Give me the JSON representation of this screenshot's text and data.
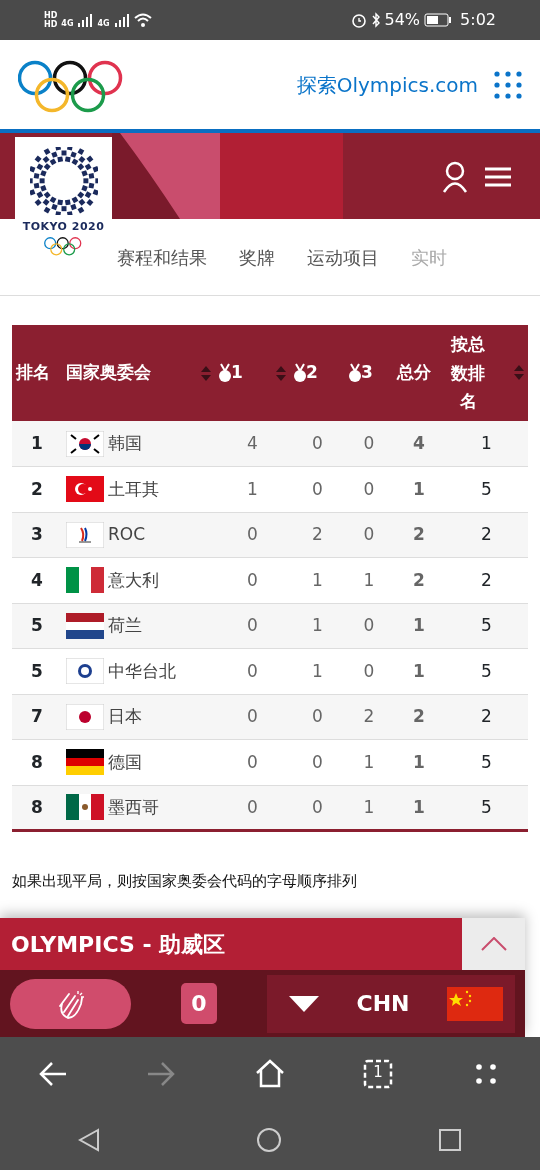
{
  "status_bar": {
    "sim_labels": [
      "HD",
      "HD"
    ],
    "network_labels": [
      "4G",
      "4G"
    ],
    "battery": "54%",
    "time": "5:02"
  },
  "header": {
    "link": "探索Olympics.com",
    "emblem_text": "TOKYO 2020"
  },
  "tabs": [
    {
      "label": "赛程和结果",
      "selected": false
    },
    {
      "label": "奖牌",
      "selected": false
    },
    {
      "label": "运动项目",
      "selected": false
    },
    {
      "label": "实时",
      "selected": false
    }
  ],
  "table": {
    "columns": [
      {
        "label": "排名",
        "kind": "text",
        "sortable": false
      },
      {
        "label": "国家奥委会",
        "kind": "text",
        "sortable": true
      },
      {
        "label": "1",
        "kind": "medal",
        "sortable": true
      },
      {
        "label": "2",
        "kind": "medal",
        "sortable": false
      },
      {
        "label": "3",
        "kind": "medal",
        "sortable": false
      },
      {
        "label": "总分",
        "kind": "text",
        "sortable": false
      },
      {
        "label": "按总数排名",
        "kind": "text",
        "sortable": true
      }
    ],
    "rows": [
      {
        "rank": "1",
        "flag": {
          "kind": "kor"
        },
        "noc": "韩国",
        "gold": "4",
        "silver": "0",
        "bronze": "0",
        "total": "4",
        "rank_by_total": "1"
      },
      {
        "rank": "2",
        "flag": {
          "kind": "tur"
        },
        "noc": "土耳其",
        "gold": "1",
        "silver": "0",
        "bronze": "0",
        "total": "1",
        "rank_by_total": "5"
      },
      {
        "rank": "3",
        "flag": {
          "kind": "roc"
        },
        "noc": "ROC",
        "gold": "0",
        "silver": "2",
        "bronze": "0",
        "total": "2",
        "rank_by_total": "2"
      },
      {
        "rank": "4",
        "flag": {
          "kind": "ita"
        },
        "noc": "意大利",
        "gold": "0",
        "silver": "1",
        "bronze": "1",
        "total": "2",
        "rank_by_total": "2"
      },
      {
        "rank": "5",
        "flag": {
          "kind": "ned"
        },
        "noc": "荷兰",
        "gold": "0",
        "silver": "1",
        "bronze": "0",
        "total": "1",
        "rank_by_total": "5"
      },
      {
        "rank": "5",
        "flag": {
          "kind": "tpe"
        },
        "noc": "中华台北",
        "gold": "0",
        "silver": "1",
        "bronze": "0",
        "total": "1",
        "rank_by_total": "5"
      },
      {
        "rank": "7",
        "flag": {
          "kind": "jpn"
        },
        "noc": "日本",
        "gold": "0",
        "silver": "0",
        "bronze": "2",
        "total": "2",
        "rank_by_total": "2"
      },
      {
        "rank": "8",
        "flag": {
          "kind": "ger"
        },
        "noc": "德国",
        "gold": "0",
        "silver": "0",
        "bronze": "1",
        "total": "1",
        "rank_by_total": "5"
      },
      {
        "rank": "8",
        "flag": {
          "kind": "mex"
        },
        "noc": "墨西哥",
        "gold": "0",
        "silver": "0",
        "bronze": "1",
        "total": "1",
        "rank_by_total": "5"
      }
    ]
  },
  "note": "如果出现平局，则按国家奥委会代码的字母顺序排列",
  "cheer_zone": {
    "title": "OLYMPICS - 助威区",
    "count": "0",
    "country": "CHN",
    "flag": {
      "kind": "chn"
    },
    "expanded": false
  },
  "browser_bar": [
    {
      "kind": "back",
      "disabled": false
    },
    {
      "kind": "forward",
      "disabled": true
    },
    {
      "kind": "home",
      "disabled": false
    },
    {
      "kind": "tabs",
      "label": "1",
      "disabled": false
    },
    {
      "kind": "more",
      "disabled": false
    }
  ]
}
